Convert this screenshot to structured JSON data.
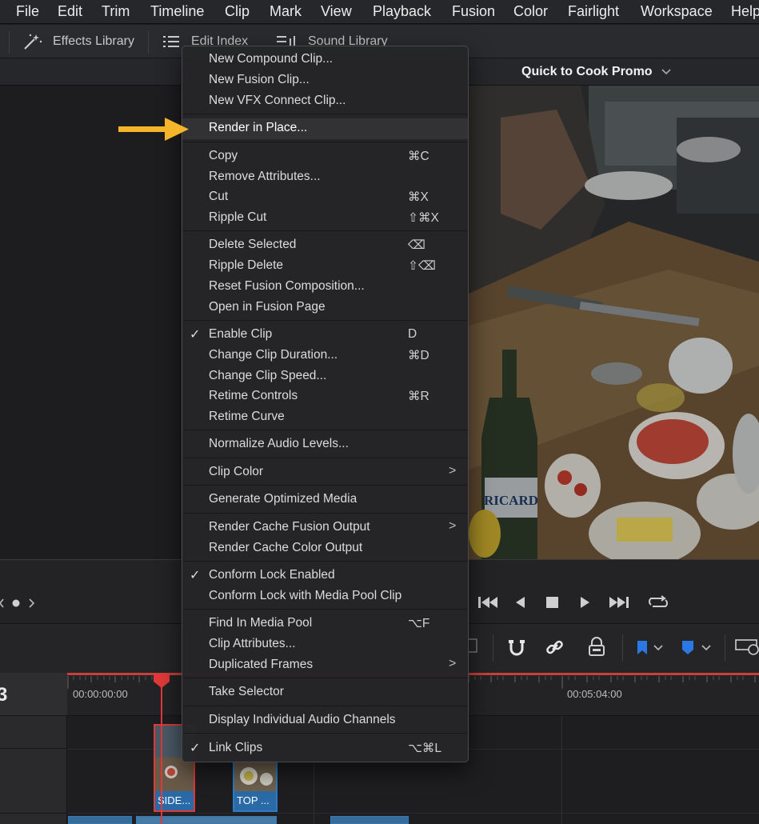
{
  "menubar": {
    "items": [
      "File",
      "Edit",
      "Trim",
      "Timeline",
      "Clip",
      "Mark",
      "View",
      "Playback",
      "Fusion",
      "Color",
      "Fairlight",
      "Workspace",
      "Help"
    ]
  },
  "toolbar": {
    "effects_library": "Effects Library",
    "edit_index": "Edit Index",
    "sound_library": "Sound Library"
  },
  "viewer": {
    "title": "Quick to Cook Promo",
    "bottle_label": "RICARD"
  },
  "timeline": {
    "timecode_start": "00:00:00:00",
    "timecode_mid": "00:05:04:00",
    "track_label": "3",
    "clips": [
      "SIDE...",
      "TOP ..."
    ]
  },
  "context_menu": {
    "items": [
      {
        "label": "New Compound Clip...",
        "shortcut": ""
      },
      {
        "label": "New Fusion Clip...",
        "shortcut": ""
      },
      {
        "label": "New VFX Connect Clip...",
        "shortcut": ""
      },
      {
        "label": "Render in Place...",
        "shortcut": "",
        "highlighted": true
      },
      {
        "label": "Copy",
        "shortcut": "⌘C"
      },
      {
        "label": "Remove Attributes...",
        "shortcut": ""
      },
      {
        "label": "Cut",
        "shortcut": "⌘X"
      },
      {
        "label": "Ripple Cut",
        "shortcut": "⇧⌘X"
      },
      {
        "label": "Delete Selected",
        "shortcut": "⌫"
      },
      {
        "label": "Ripple Delete",
        "shortcut": "⇧⌫"
      },
      {
        "label": "Reset Fusion Composition...",
        "shortcut": ""
      },
      {
        "label": "Open in Fusion Page",
        "shortcut": ""
      },
      {
        "label": "Enable Clip",
        "shortcut": "D",
        "checked": true
      },
      {
        "label": "Change Clip Duration...",
        "shortcut": "⌘D"
      },
      {
        "label": "Change Clip Speed...",
        "shortcut": ""
      },
      {
        "label": "Retime Controls",
        "shortcut": "⌘R"
      },
      {
        "label": "Retime Curve",
        "shortcut": ""
      },
      {
        "label": "Normalize Audio Levels...",
        "shortcut": ""
      },
      {
        "label": "Clip Color",
        "shortcut": "",
        "submenu": true
      },
      {
        "label": "Generate Optimized Media",
        "shortcut": ""
      },
      {
        "label": "Render Cache Fusion Output",
        "shortcut": "",
        "submenu": true
      },
      {
        "label": "Render Cache Color Output",
        "shortcut": ""
      },
      {
        "label": "Conform Lock Enabled",
        "shortcut": "",
        "checked": true
      },
      {
        "label": "Conform Lock with Media Pool Clip",
        "shortcut": ""
      },
      {
        "label": "Find In Media Pool",
        "shortcut": "⌥F"
      },
      {
        "label": "Clip Attributes...",
        "shortcut": ""
      },
      {
        "label": "Duplicated Frames",
        "shortcut": "",
        "submenu": true
      },
      {
        "label": "Take Selector",
        "shortcut": ""
      },
      {
        "label": "Display Individual Audio Channels",
        "shortcut": ""
      },
      {
        "label": "Link Clips",
        "shortcut": "⌥⌘L",
        "checked": true
      }
    ],
    "check_glyph": "✓",
    "submenu_glyph": ">"
  },
  "colors": {
    "highlight_arrow": "#f5b52a",
    "playhead": "#e0393a",
    "clip_blue": "#2a6aa6",
    "marker_blue": "#2b78e4"
  },
  "icons": {
    "effects": "magic-wand-icon",
    "edit_index": "list-icon",
    "sound_library": "sound-library-icon"
  }
}
